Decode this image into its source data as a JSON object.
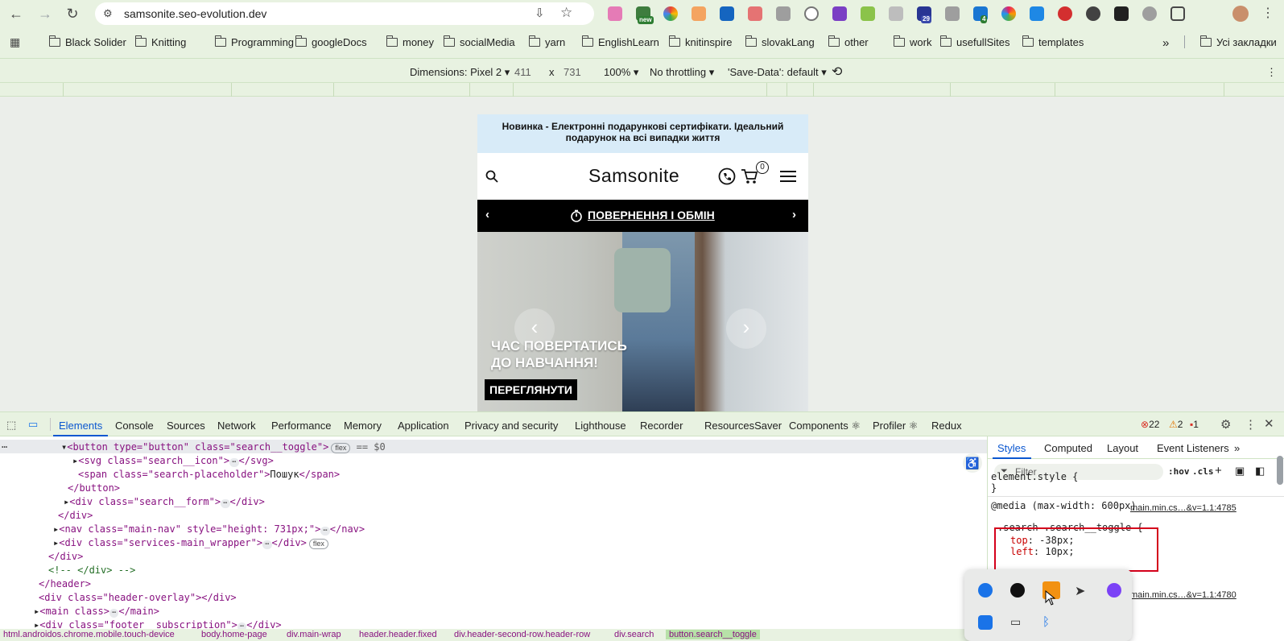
{
  "browser": {
    "url": "samsonite.seo-evolution.dev",
    "ext_badges": {
      "new": "new",
      "b1": "29",
      "b2": "4"
    },
    "bookmarks": [
      "Black Solider",
      "Knitting",
      "Programming",
      "googleDocs",
      "money",
      "socialMedia",
      "yarn",
      "EnglishLearn",
      "knitinspire",
      "slovakLang",
      "other",
      "work",
      "usefullSites",
      "templates"
    ],
    "all_bookmarks": "Усі закладки"
  },
  "device_toolbar": {
    "dimensions": "Dimensions: Pixel 2",
    "width": "411",
    "x": "x",
    "height": "731",
    "zoom": "100%",
    "throttling": "No throttling",
    "save_data": "'Save-Data': default"
  },
  "site": {
    "promo": "Новинка - Електронні подарункові сертифікати. Ідеальний подарунок на всі випадки життя",
    "logo": "Samsonite",
    "cart_count": "0",
    "returns_link": "ПОВЕРНЕННЯ І ОБМІН",
    "hero_title_1": "ЧАС ПОВЕРТАТИСЬ",
    "hero_title_2": "ДО НАВЧАННЯ!",
    "hero_button": "ПЕРЕГЛЯНУТИ"
  },
  "devtools": {
    "tabs": [
      "Elements",
      "Console",
      "Sources",
      "Network",
      "Performance",
      "Memory",
      "Application",
      "Privacy and security",
      "Lighthouse",
      "Recorder",
      "ResourcesSaver",
      "Components ⚛",
      "Profiler ⚛",
      "Redux"
    ],
    "errors": "22",
    "warnings": "2",
    "issues": "1",
    "dom": {
      "l1_tag": "<button type=\"button\" class=\"search__toggle\">",
      "l1_badge": "flex",
      "l1_eq": "== $0",
      "l2": "<svg class=\"search__icon\">",
      "l2_end": "</svg>",
      "l3_open": "<span class=\"search-placeholder\">",
      "l3_text": "Пошук",
      "l3_close": "</span>",
      "l4": "</button>",
      "l5": "<div class=\"search__form\">",
      "l5_end": "</div>",
      "l6": "</div>",
      "l7": "<nav class=\"main-nav\" style=\"height: 731px;\">",
      "l7_end": "</nav>",
      "l8": "<div class=\"services-main_wrapper\">",
      "l8_end": "</div>",
      "l8_badge": "flex",
      "l9": "</div>",
      "l10": "<!-- </div> -->",
      "l11": "</header>",
      "l12": "<div class=\"header-overlay\"></div>",
      "l13": "<main class>",
      "l13_end": "</main>",
      "l14": "<div class=\"footer__subscription\">",
      "l14_end": "</div>"
    },
    "breadcrumbs": [
      "html.androidos.chrome.mobile.touch-device",
      "body.home-page",
      "div.main-wrap",
      "header.header.fixed",
      "div.header-second-row.header-row",
      "div.search",
      "button.search__toggle"
    ],
    "styles": {
      "tabs": [
        "Styles",
        "Computed",
        "Layout",
        "Event Listeners"
      ],
      "filter_placeholder": "Filter",
      "hov": ":hov",
      "cls": ".cls",
      "element_style": "element.style {",
      "close": "}",
      "media": "@media (max-width: 600px)",
      "src1": "main.min.cs…&v=1.1:4785",
      "selector": ".search .search__toggle {",
      "p1_name": "top",
      "p1_val": "-38px;",
      "p2_name": "left",
      "p2_val": "10px;",
      "src2": "main.min.cs…&v=1.1:4780"
    }
  }
}
